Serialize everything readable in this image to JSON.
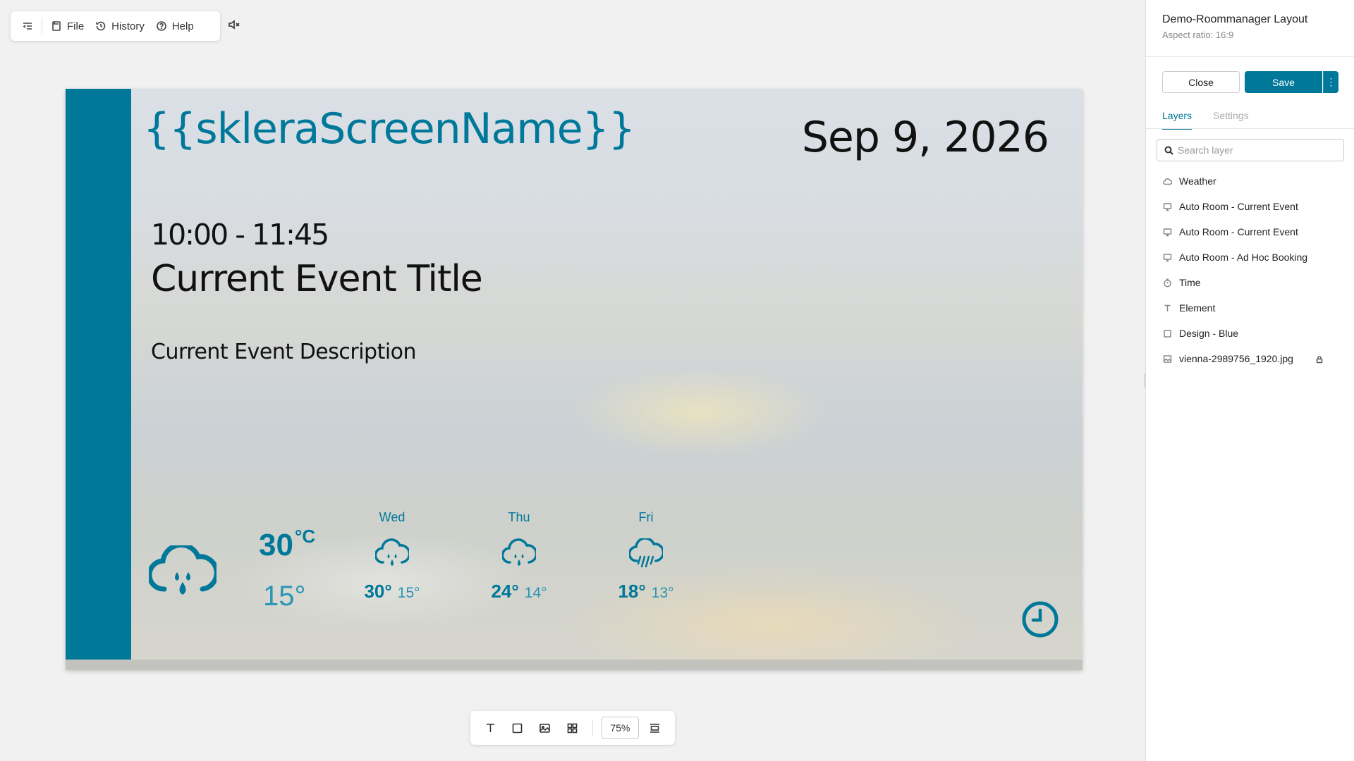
{
  "topbar": {
    "file_label": "File",
    "history_label": "History",
    "help_label": "Help"
  },
  "canvas": {
    "screen_name": "{{skleraScreenName}}",
    "date": "Sep 9, 2026",
    "time_range": "10:00 - 11:45",
    "event_title": "Current Event Title",
    "event_description": "Current Event Description",
    "weather": {
      "current_high": "30",
      "current_unit": "°C",
      "current_low": "15°",
      "forecast": [
        {
          "day": "Wed",
          "high": "30°",
          "low": "15°",
          "icon": "cloud-rain-icon"
        },
        {
          "day": "Thu",
          "high": "24°",
          "low": "14°",
          "icon": "cloud-rain-icon"
        },
        {
          "day": "Fri",
          "high": "18°",
          "low": "13°",
          "icon": "cloud-showers-icon"
        }
      ]
    }
  },
  "bottombar": {
    "zoom": "75%"
  },
  "panel": {
    "title": "Demo-Roommanager Layout",
    "subtitle": "Aspect ratio: 16:9",
    "close_label": "Close",
    "save_label": "Save",
    "more_label": "⋮",
    "tabs": {
      "layers": "Layers",
      "settings": "Settings"
    },
    "search_placeholder": "Search layer",
    "layers": [
      {
        "label": "Weather",
        "icon": "cloud-icon"
      },
      {
        "label": "Auto Room - Current Event",
        "icon": "monitor-icon"
      },
      {
        "label": "Auto Room - Current Event",
        "icon": "monitor-icon"
      },
      {
        "label": "Auto Room - Ad Hoc Booking",
        "icon": "monitor-icon"
      },
      {
        "label": "Time",
        "icon": "timer-icon"
      },
      {
        "label": "Element",
        "icon": "text-icon"
      },
      {
        "label": "Design - Blue",
        "icon": "square-icon"
      },
      {
        "label": "vienna-2989756_1920.jpg",
        "icon": "image-icon"
      }
    ]
  },
  "colors": {
    "accent": "#00789a",
    "accent_light": "#2b95b4"
  }
}
